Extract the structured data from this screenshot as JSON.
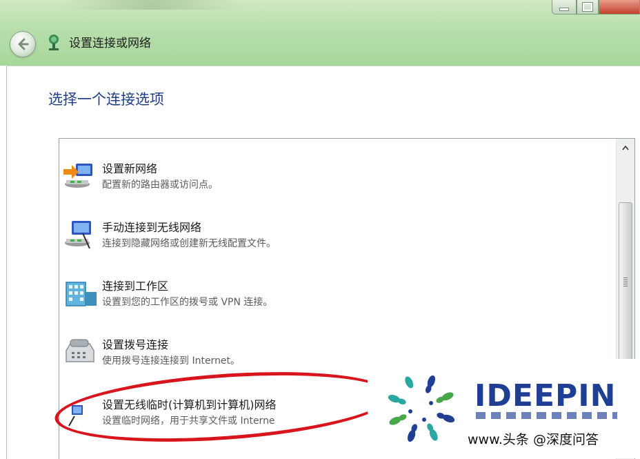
{
  "window": {
    "title": "设置连接或网络",
    "caption_buttons": [
      "minimize",
      "maximize",
      "close"
    ],
    "back_icon": "back-arrow-icon",
    "title_icon": "network-setup-icon"
  },
  "main": {
    "heading": "选择一个连接选项",
    "options": [
      {
        "title": "设置新网络",
        "description": "配置新的路由器或访问点。",
        "icon": "new-network-icon"
      },
      {
        "title": "手动连接到无线网络",
        "description": "连接到隐藏网络或创建新无线配置文件。",
        "icon": "wireless-manual-icon"
      },
      {
        "title": "连接到工作区",
        "description": "设置到您的工作区的拨号或 VPN 连接。",
        "icon": "workplace-icon"
      },
      {
        "title": "设置拨号连接",
        "description": "使用拨号连接连接到 Internet。",
        "icon": "dialup-phone-icon"
      },
      {
        "title": "设置无线临时(计算机到计算机)网络",
        "description": "设置临时网络，用于共享文件或 Interne",
        "icon": "adhoc-network-icon"
      }
    ]
  },
  "annotation": {
    "color": "#d8141c",
    "target": "设置无线临时(计算机到计算机)网络"
  },
  "watermark": {
    "brand": "IDEEPIN",
    "footer": "www.头条 @深度问答"
  },
  "colors": {
    "chrome_green": "#b9dfae",
    "heading_blue": "#1e3f84",
    "brand_blue": "#1f3f95"
  }
}
